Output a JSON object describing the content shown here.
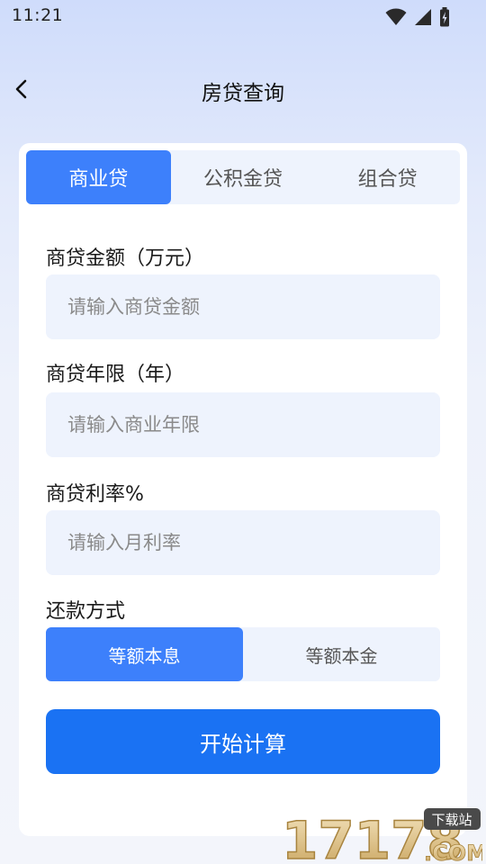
{
  "status_bar": {
    "time": "11:21"
  },
  "header": {
    "title": "房贷查询"
  },
  "tabs": [
    {
      "label": "商业贷",
      "active": true
    },
    {
      "label": "公积金贷",
      "active": false
    },
    {
      "label": "组合贷",
      "active": false
    }
  ],
  "form": {
    "amount": {
      "label": "商贷金额（万元）",
      "placeholder": "请输入商贷金额",
      "value": ""
    },
    "years": {
      "label": "商贷年限（年）",
      "placeholder": "请输入商业年限",
      "value": ""
    },
    "rate": {
      "label": "商贷利率%",
      "placeholder": "请输入月利率",
      "value": ""
    },
    "repayment": {
      "label": "还款方式",
      "options": [
        {
          "label": "等额本息",
          "active": true
        },
        {
          "label": "等额本金",
          "active": false
        }
      ]
    },
    "submit_label": "开始计算"
  },
  "watermark": {
    "text": "17178",
    "domain": ".COM",
    "badge": "下载站"
  },
  "colors": {
    "accent": "#3d80fb",
    "button": "#1a72f3",
    "field_bg": "#eef3fd"
  }
}
